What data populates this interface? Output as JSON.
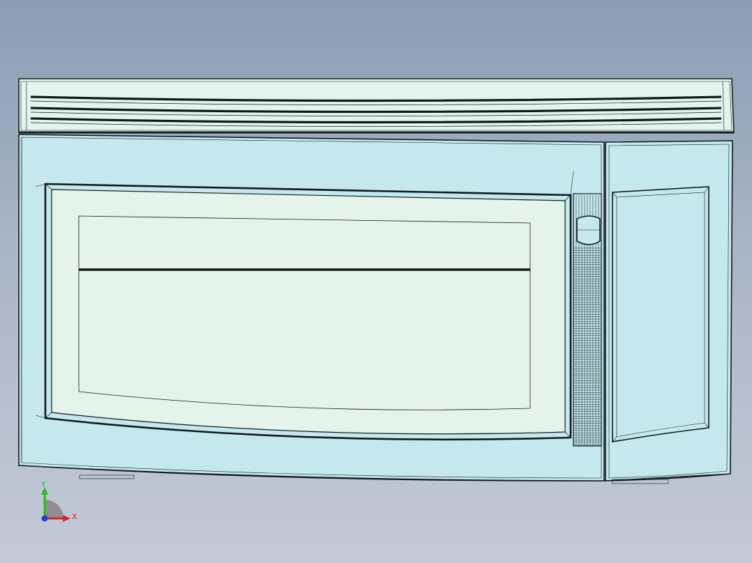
{
  "viewport": {
    "background_top": "#8b9db4",
    "background_bottom": "#c4cad6"
  },
  "model": {
    "type": "over-the-range microwave oven, front view",
    "face_color": "#c5e8ef",
    "glass_color": "#e4f4ea",
    "edge_color": "#0e1a1a"
  },
  "triad": {
    "x_label": "X",
    "y_label": "Y",
    "x_color": "#e02020",
    "y_color": "#20c020",
    "z_color": "#2040e0"
  }
}
